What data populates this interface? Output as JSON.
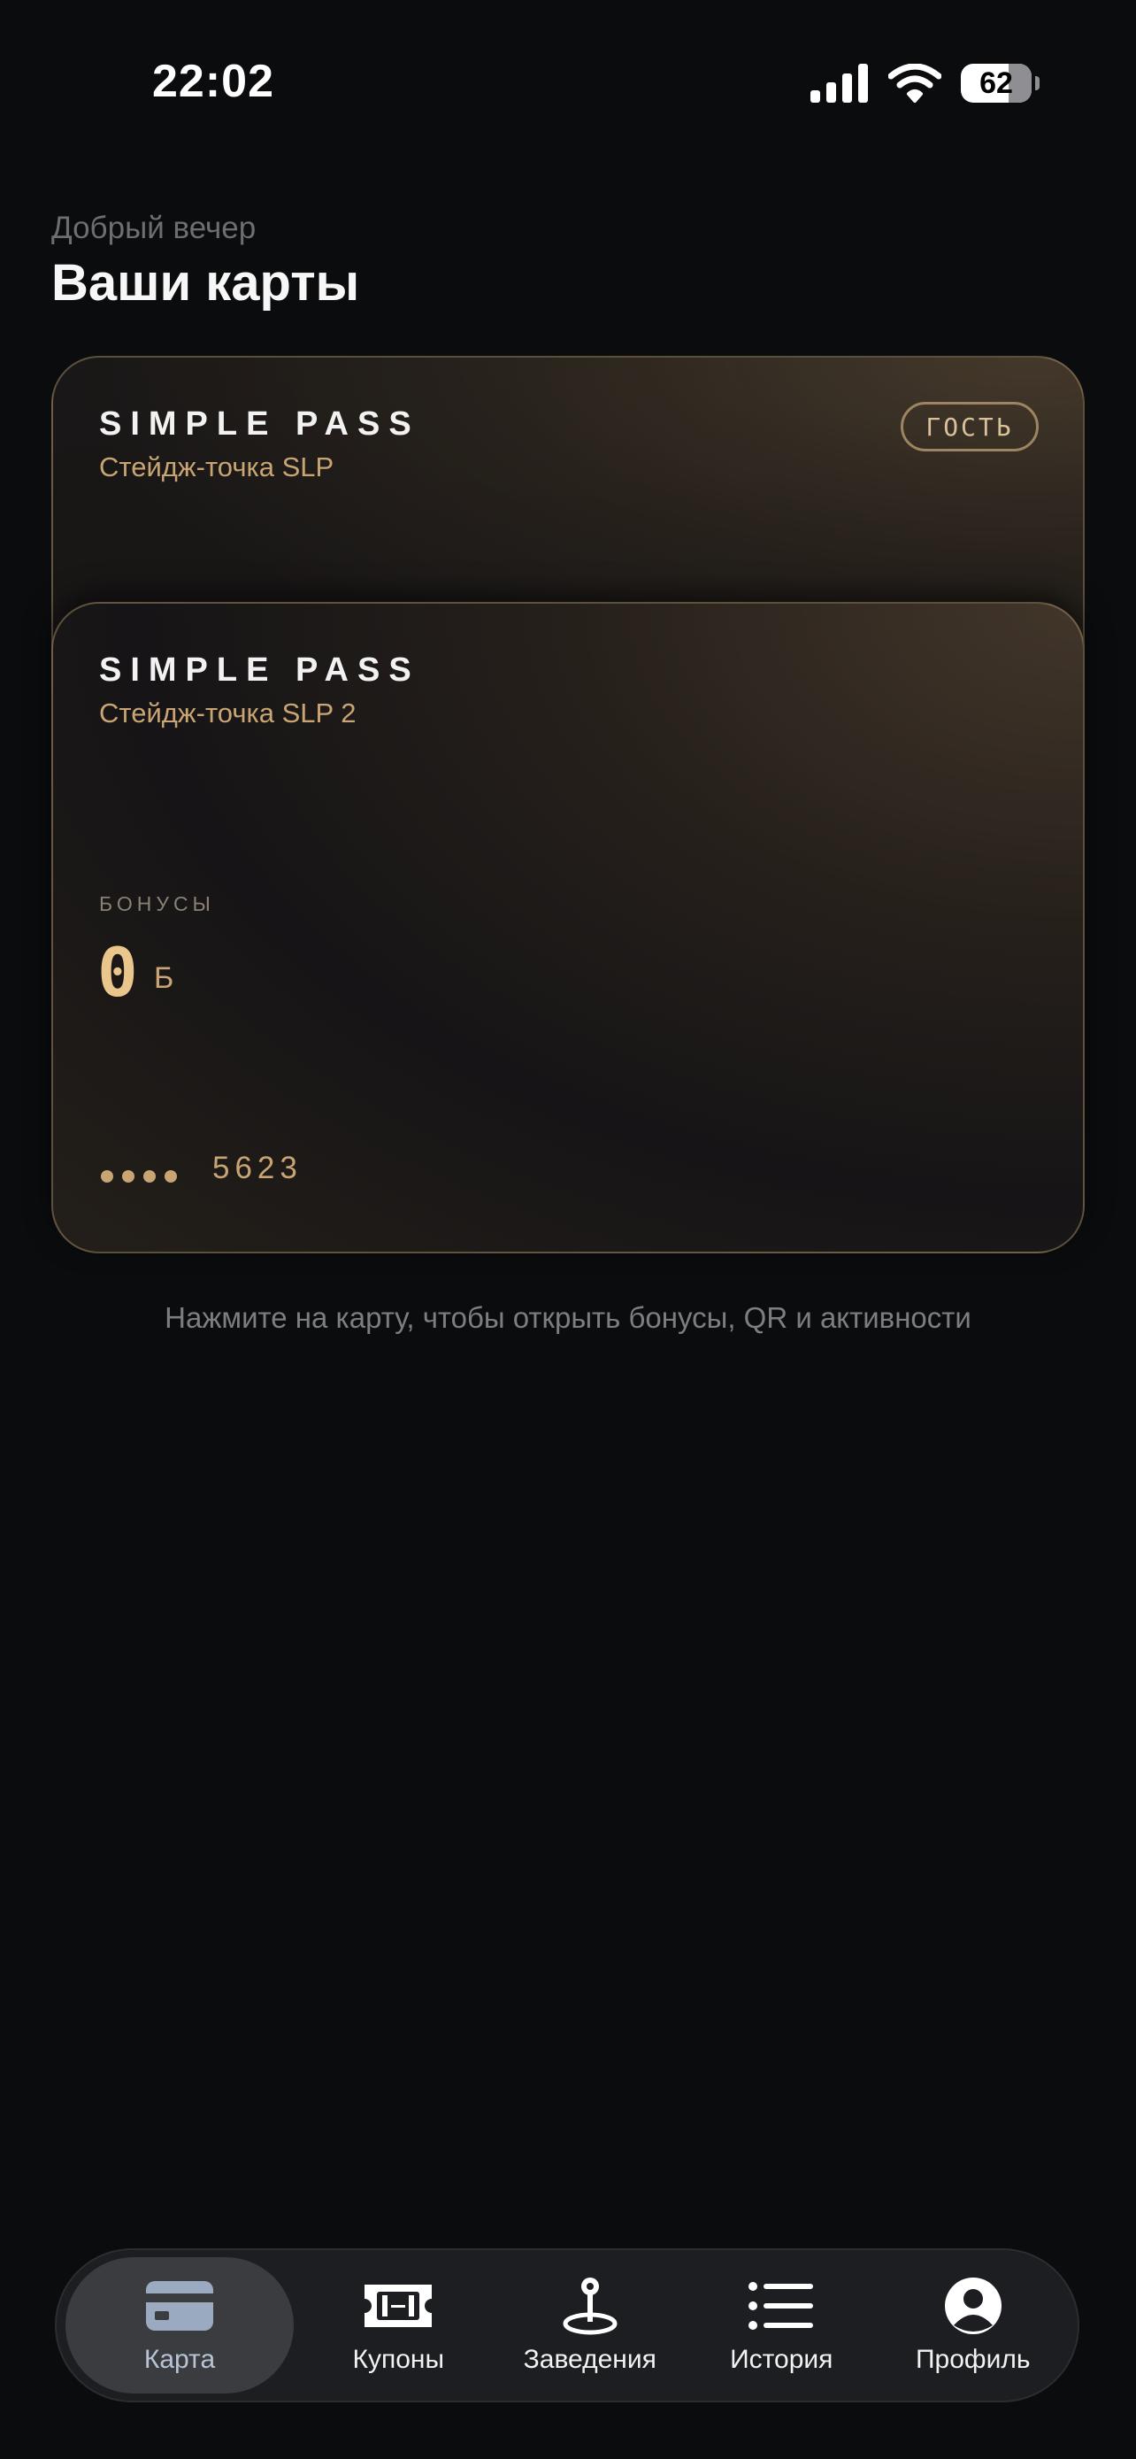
{
  "status_bar": {
    "time": "22:02",
    "battery": "62"
  },
  "header": {
    "greeting": "Добрый вечер",
    "title": "Ваши карты"
  },
  "cards": [
    {
      "brand": "SIMPLE PASS",
      "venue": "Стейдж-точка SLP",
      "badge": "ГОСТЬ"
    },
    {
      "brand": "SIMPLE PASS",
      "venue": "Стейдж-точка SLP 2",
      "bonus_label": "БОНУСЫ",
      "bonus_value": "0",
      "bonus_unit": "Б",
      "masked_number": "5623"
    }
  ],
  "hint": "Нажмите на карту, чтобы открыть бонусы, QR и активности",
  "tabs": [
    {
      "label": "Карта",
      "icon": "card-icon",
      "active": true
    },
    {
      "label": "Купоны",
      "icon": "ticket-icon",
      "active": false
    },
    {
      "label": "Заведения",
      "icon": "map-pin-icon",
      "active": false
    },
    {
      "label": "История",
      "icon": "list-icon",
      "active": false
    },
    {
      "label": "Профиль",
      "icon": "person-icon",
      "active": false
    }
  ],
  "colors": {
    "accent": "#c9a574",
    "background": "#0b0c0e",
    "active_tab": "#b8c4d6"
  }
}
